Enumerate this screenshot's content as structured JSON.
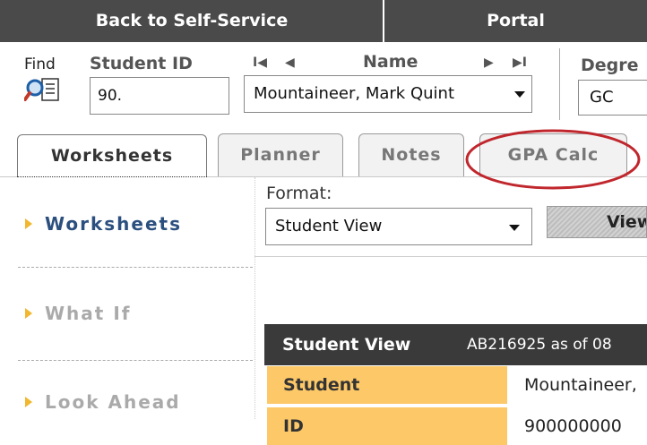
{
  "topbar": {
    "back_label": "Back to Self-Service",
    "portal_label": "Portal"
  },
  "header": {
    "find_label": "Find",
    "student_id_label": "Student ID",
    "student_id_value": "90.",
    "nav_first": "I◀",
    "nav_prev": "◀",
    "name_label": "Name",
    "nav_next": "▶",
    "nav_last": "▶I",
    "name_value": "Mountaineer, Mark Quint",
    "degree_label": "Degre",
    "degree_value": "GC"
  },
  "tabs": [
    {
      "label": "Worksheets",
      "active": true
    },
    {
      "label": "Planner",
      "active": false
    },
    {
      "label": "Notes",
      "active": false
    },
    {
      "label": "GPA Calc",
      "active": false
    }
  ],
  "sidebar": {
    "items": [
      {
        "label": "Worksheets"
      },
      {
        "label": "What If"
      },
      {
        "label": "Look Ahead"
      }
    ]
  },
  "main": {
    "format_label": "Format:",
    "format_value": "Student View",
    "view_button": "View",
    "student_view_title": "Student View",
    "student_view_info": "AB216925 as of 08",
    "rows": [
      {
        "label": "Student",
        "value": "Mountaineer,"
      },
      {
        "label": "ID",
        "value": "900000000"
      }
    ]
  },
  "colors": {
    "topbar": "#4a4a4a",
    "accent_link": "#2b4f7e",
    "row_label_bg": "#fdc867",
    "annotation_circle": "#c0272d"
  }
}
